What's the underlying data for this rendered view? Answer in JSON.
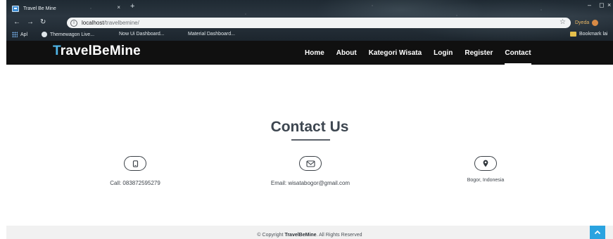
{
  "browser": {
    "tab_title": "Travel Be Mine",
    "tab_close": "×",
    "new_tab": "+",
    "window_controls": {
      "minimize": "‒",
      "maximize": "◻",
      "close": "×"
    },
    "url_host": "localhost",
    "url_path": "/travelbemine/",
    "info_glyph": "ⓘ",
    "profile_name": "Dyeda",
    "bookmarks": [
      "Apl",
      "Themewagon Live...",
      "Now Ui Dashboard...",
      "Material Dashboard..."
    ],
    "bookmark_folder": "Bookmark lai"
  },
  "site": {
    "brand_first_letter": "T",
    "brand_rest": "ravelBeMine",
    "menu": [
      "Home",
      "About",
      "Kategori Wisata",
      "Login",
      "Register",
      "Contact"
    ],
    "active_menu": "Contact"
  },
  "contact": {
    "title": "Contact Us",
    "phone": "Call: 083872595279",
    "email": "Email: wisatabogor@gmail.com",
    "address": "Bogor, Indonesia"
  },
  "footer": {
    "prefix": "© Copyright ",
    "brand": "TravelBeMine",
    "suffix": ". All Rights Reserved"
  },
  "icons": {
    "phone": "phone-icon",
    "email": "envelope-icon",
    "address": "map-pin-icon",
    "back_to_top": "chevron-up-icon"
  },
  "colors": {
    "navbar_bg": "#101010",
    "brand_accent": "#4fb6e8",
    "back_to_top": "#2aa3e0",
    "footer_bg": "#f1f1f1"
  }
}
